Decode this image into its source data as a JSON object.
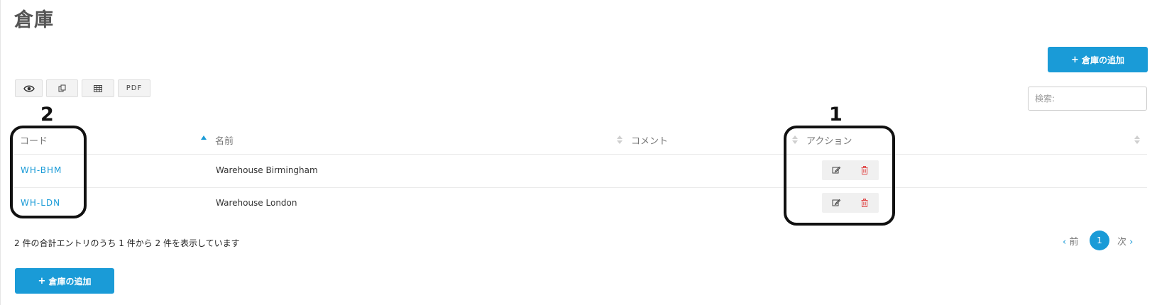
{
  "page": {
    "title": "倉庫"
  },
  "toolbar": {
    "add_button_label": "倉庫の追加",
    "copy_icon": "copy-icon",
    "view_icon": "eye-icon",
    "csv_icon": "table-icon",
    "pdf_label": "PDF",
    "search_placeholder": "検索:"
  },
  "table": {
    "columns": [
      "コード",
      "名前",
      "コメント",
      "アクション"
    ],
    "rows": [
      {
        "code": "WH-BHM",
        "name": "Warehouse Birmingham",
        "comment": ""
      },
      {
        "code": "WH-LDN",
        "name": "Warehouse London",
        "comment": ""
      }
    ],
    "sorted_column": "コード",
    "sort_direction": "asc"
  },
  "footer": {
    "info": "2 件の合計エントリのうち 1 件から 2 件を表示しています",
    "prev_label": "前",
    "current_page": "1",
    "next_label": "次"
  },
  "annotations": {
    "callout_1": "1",
    "callout_2": "2"
  },
  "colors": {
    "accent": "#1a9bd7",
    "delete": "#e04a4a",
    "annotation": "#111111"
  }
}
